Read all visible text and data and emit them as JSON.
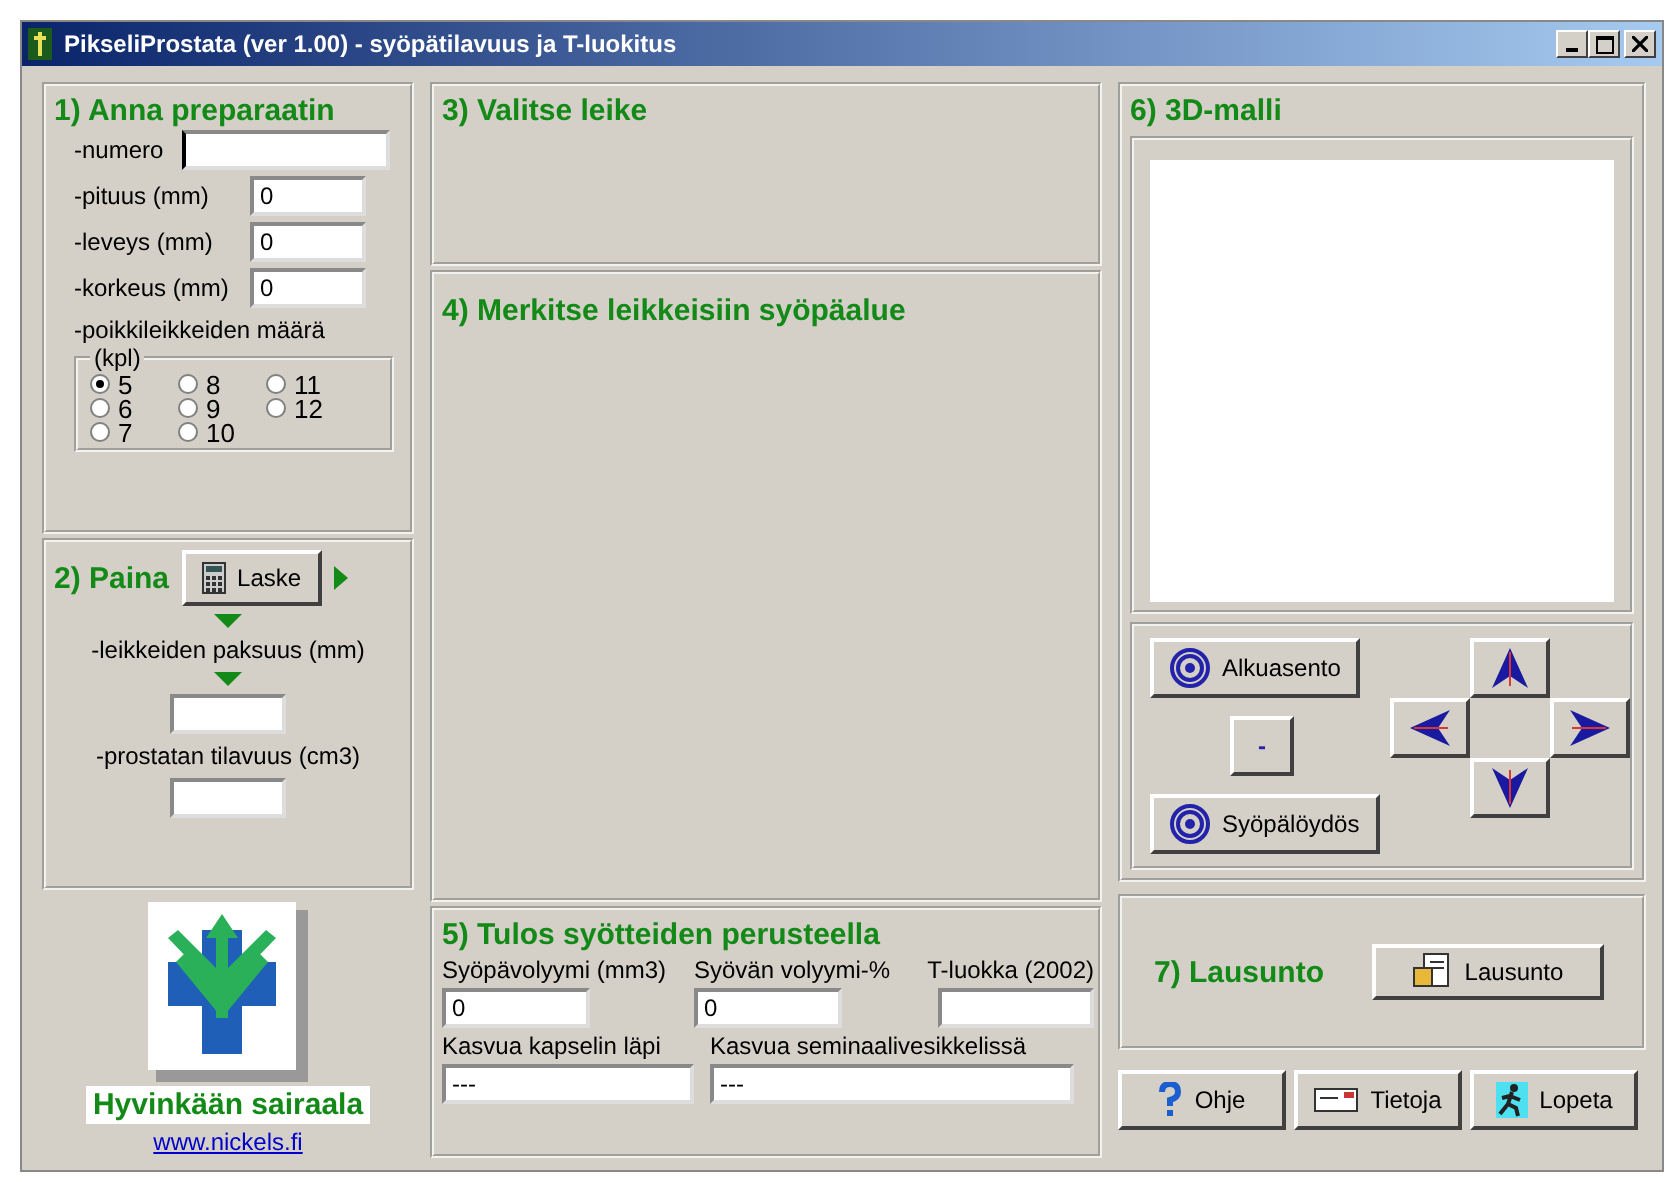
{
  "window": {
    "title": "PikseliProstata (ver 1.00) - syöpätilavuus ja T-luokitus"
  },
  "panel_1": {
    "heading": "1) Anna preparaatin",
    "fields": [
      {
        "label": "-numero",
        "focused": true
      },
      {
        "label": "-pituus  (mm)",
        "value": "0",
        "focused": false
      },
      {
        "label": "-leveys (mm)",
        "value": "0",
        "focused": false
      },
      {
        "label": "-korkeus (mm)",
        "value": "0",
        "focused": false
      }
    ],
    "sections_label": "-poikkileikkeiden määrä",
    "group_label": "(kpl)",
    "options": [
      {
        "label": "5",
        "selected": true
      },
      {
        "label": "6",
        "selected": false
      },
      {
        "label": "7",
        "selected": false
      },
      {
        "label": "8",
        "selected": false
      },
      {
        "label": "9",
        "selected": false
      },
      {
        "label": "10",
        "selected": false
      },
      {
        "label": "11",
        "selected": false
      },
      {
        "label": "12",
        "selected": false
      }
    ]
  },
  "panel_2": {
    "heading": "2) Paina",
    "button": "Laske",
    "thickness_label": "-leikkeiden paksuus (mm)",
    "volume_label": "-prostatan tilavuus (cm3)"
  },
  "logo": {
    "name": "Hyvinkään sairaala",
    "link": "www.nickels.fi"
  },
  "panel_3": {
    "heading": "3) Valitse leike"
  },
  "panel_4": {
    "heading": "4) Merkitse leikkeisiin syöpäalue"
  },
  "panel_5": {
    "heading": "5) Tulos syötteiden perusteella",
    "row_1": [
      {
        "label": "Syöpävolyymi (mm3)",
        "value": "0"
      },
      {
        "label": "Syövän volyymi-%",
        "value": "0"
      },
      {
        "label": "T-luokka (2002)"
      }
    ],
    "row_2": [
      {
        "label": "Kasvua kapselin läpi",
        "value": "---"
      },
      {
        "label": "Kasvua seminaalivesikkelissä",
        "value": "---"
      }
    ]
  },
  "panel_6": {
    "heading": "6) 3D-malli",
    "reset_button": "Alkuasento",
    "minus_button": "-",
    "finding_button": "Syöpälöydös"
  },
  "panel_7": {
    "heading": "7) Lausunto",
    "button": "Lausunto"
  },
  "buttons": [
    {
      "label": "Ohje",
      "kind": "help"
    },
    {
      "label": "Tietoja",
      "kind": "info"
    },
    {
      "label": "Lopeta",
      "kind": "exit"
    }
  ]
}
